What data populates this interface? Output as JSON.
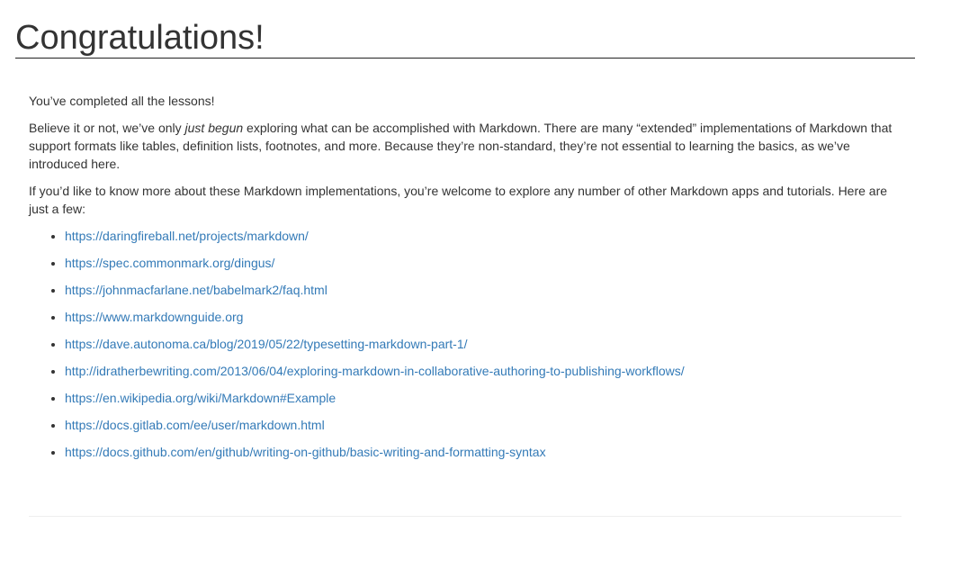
{
  "page": {
    "title": "Congratulations!"
  },
  "content": {
    "completed": "You’ve completed all the lessons!",
    "para2": {
      "before": "Believe it or not, we’ve only ",
      "emphasis": "just begun",
      "after": " exploring what can be accomplished with Markdown. There are many “extended” implementations of Markdown that support formats like tables, definition lists, footnotes, and more. Because they’re non-standard, they’re not essential to learning the basics, as we’ve introduced here."
    },
    "para3": "If you’d like to know more about these Markdown implementations, you’re welcome to explore any number of other Markdown apps and tutorials. Here are just a few:",
    "links": [
      "https://daringfireball.net/projects/markdown/",
      "https://spec.commonmark.org/dingus/",
      "https://johnmacfarlane.net/babelmark2/faq.html",
      "https://www.markdownguide.org",
      "https://dave.autonoma.ca/blog/2019/05/22/typesetting-markdown-part-1/",
      "http://idratherbewriting.com/2013/06/04/exploring-markdown-in-collaborative-authoring-to-publishing-workflows/",
      "https://en.wikipedia.org/wiki/Markdown#Example",
      "https://docs.gitlab.com/ee/user/markdown.html",
      "https://docs.github.com/en/github/writing-on-github/basic-writing-and-formatting-syntax"
    ]
  },
  "colors": {
    "text": "#333333",
    "link": "#337ab7",
    "heading_rule": "#222222",
    "divider": "#eeeeee"
  }
}
